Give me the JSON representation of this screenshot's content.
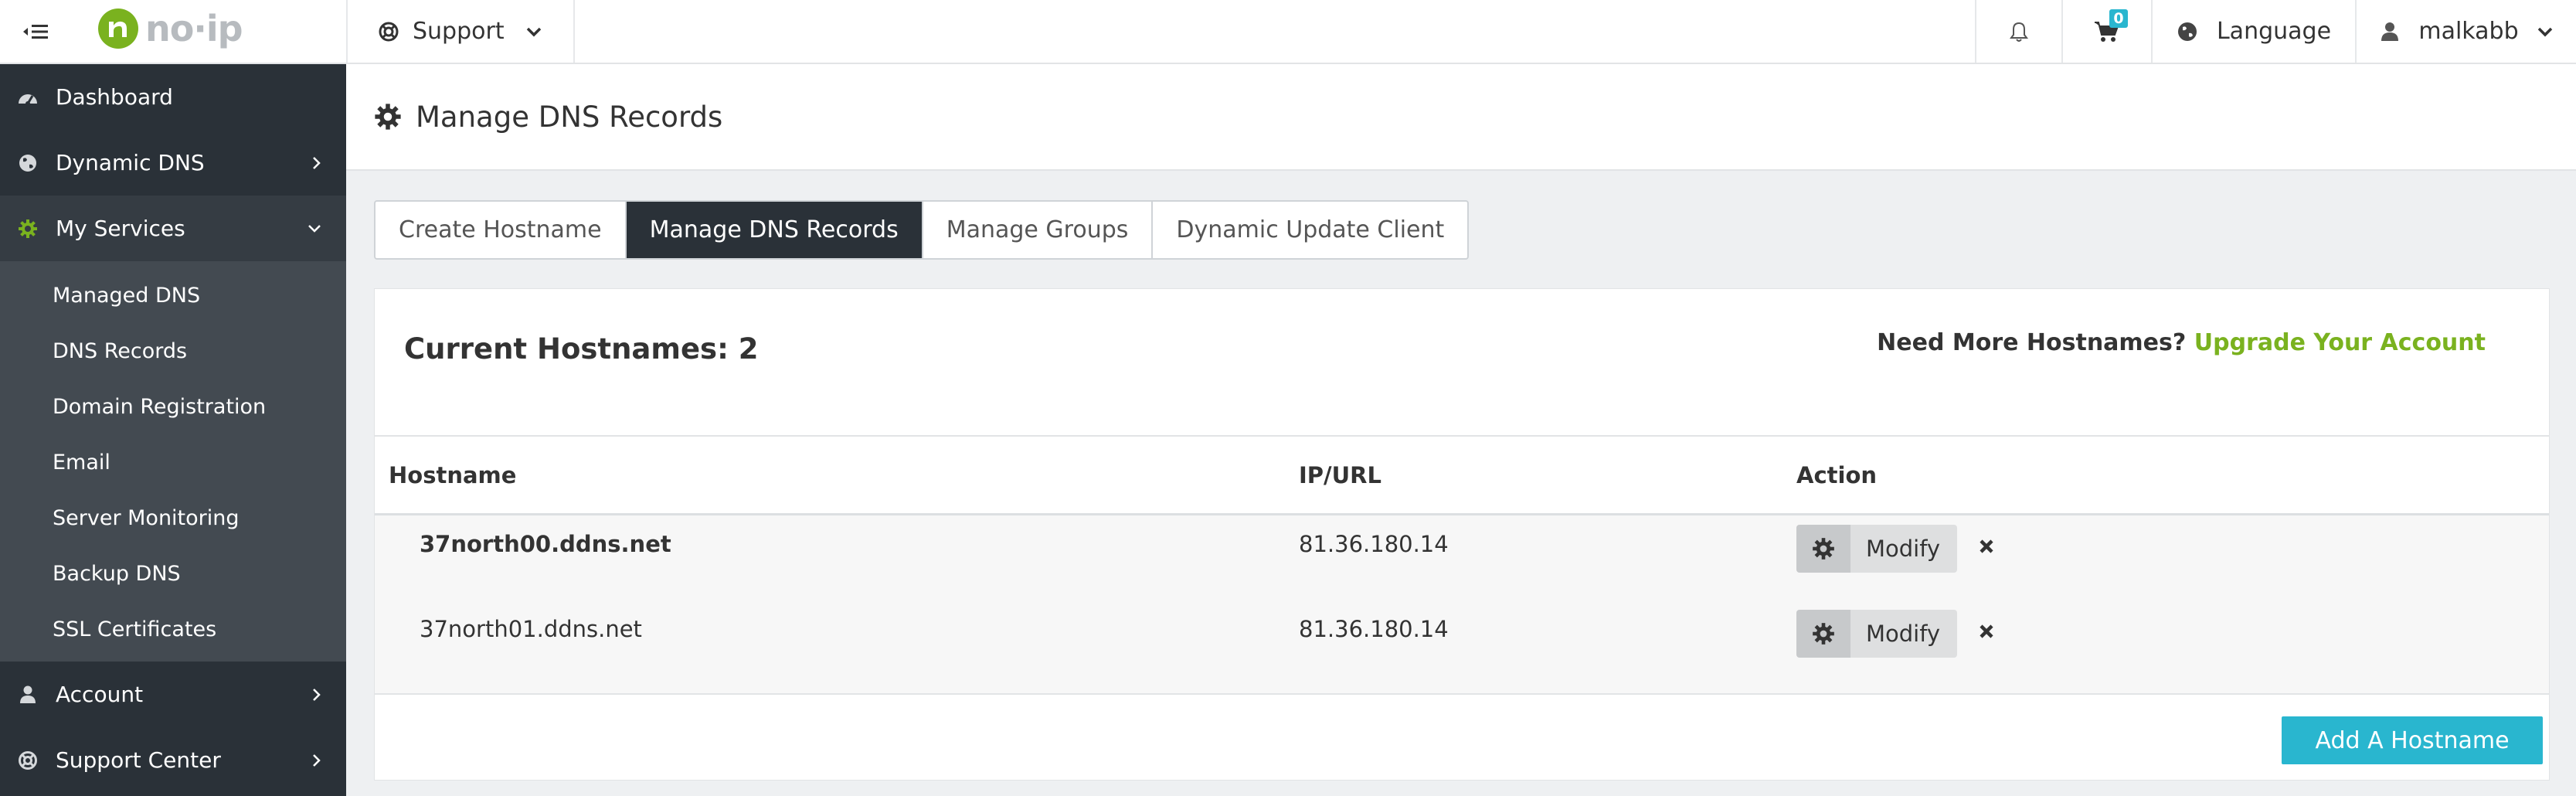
{
  "header": {
    "logo_text": "no·ip",
    "support_label": "Support",
    "cart_count": "0",
    "language_label": "Language",
    "username": "malkabb"
  },
  "sidebar": {
    "items": [
      {
        "label": "Dashboard",
        "icon": "dashboard-icon"
      },
      {
        "label": "Dynamic DNS",
        "icon": "globe-icon"
      },
      {
        "label": "My Services",
        "icon": "gear-icon",
        "active_icon_color": "#7ab21f"
      },
      {
        "label": "Account",
        "icon": "user-icon"
      },
      {
        "label": "Support Center",
        "icon": "lifebuoy-icon"
      }
    ],
    "my_services_sub": [
      "Managed DNS",
      "DNS Records",
      "Domain Registration",
      "Email",
      "Server Monitoring",
      "Backup DNS",
      "SSL Certificates"
    ]
  },
  "page": {
    "title": "Manage DNS Records"
  },
  "tabs": [
    {
      "label": "Create Hostname",
      "active": false
    },
    {
      "label": "Manage DNS Records",
      "active": true
    },
    {
      "label": "Manage Groups",
      "active": false
    },
    {
      "label": "Dynamic Update Client",
      "active": false
    }
  ],
  "card": {
    "current_hostnames": "Current Hostnames: 2",
    "need_more": "Need More Hostnames?",
    "upgrade_link": "Upgrade Your Account",
    "add_button": "Add A Hostname"
  },
  "table": {
    "columns": [
      "Hostname",
      "IP/URL",
      "Action"
    ],
    "rows": [
      {
        "hostname": "37north00.ddns.net",
        "ip": "81.36.180.14",
        "action": "Modify",
        "bold": true
      },
      {
        "hostname": "37north01.ddns.net",
        "ip": "81.36.180.14",
        "action": "Modify",
        "bold": false
      }
    ]
  },
  "colors": {
    "sidebar_bg": "#2a3138",
    "accent_green": "#7ab21f",
    "accent_teal": "#29b6cf"
  }
}
